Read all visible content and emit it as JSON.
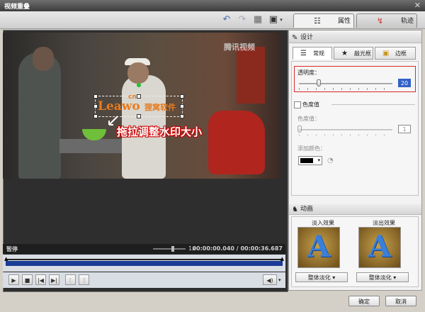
{
  "window": {
    "title": "视频重叠",
    "close_glyph": "✕"
  },
  "toolbar": {
    "undo_icon": "undo-icon",
    "redo_icon": "redo-icon",
    "grid_icon": "grid-icon",
    "screen_icon": "screen-icon"
  },
  "tabs": [
    {
      "label": "属性",
      "icon": "properties-icon"
    },
    {
      "label": "轨迹",
      "icon": "track-icon"
    }
  ],
  "video": {
    "watermark_cn": "cn",
    "watermark_brand": "Leawo",
    "watermark_sub": "狸窝软件",
    "channel_logo": "腾讯视频",
    "annotation": "拖拉调整水印大小"
  },
  "status": {
    "state": "暂停",
    "zoom": "1x",
    "time": "00:00:00.040 / 00:00:36.687"
  },
  "design": {
    "header": "设计",
    "subtabs": [
      {
        "label": "常规"
      },
      {
        "label": "敲光框"
      },
      {
        "label": "边框"
      }
    ],
    "opacity_label": "透明度：",
    "opacity_value": "20",
    "chroma_header": "色度值",
    "chroma_label": "色度值：",
    "chroma_value": "1",
    "add_color_label": "添加颜色："
  },
  "animation": {
    "header": "动画",
    "fade_in_label": "淡入效果",
    "fade_out_label": "淡出效果",
    "fade_in_select": "整体淡化",
    "fade_out_select": "整体淡化"
  },
  "buttons": {
    "ok": "确定",
    "cancel": "取消"
  }
}
